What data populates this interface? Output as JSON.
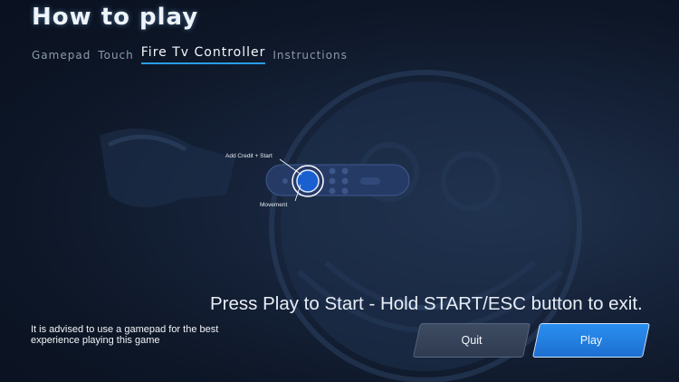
{
  "header": {
    "title": "How to play"
  },
  "tabs": [
    {
      "label": "Gamepad",
      "active": false
    },
    {
      "label": "Touch",
      "active": false
    },
    {
      "label": "Fire Tv Controller",
      "active": true
    },
    {
      "label": "Instructions",
      "active": false
    }
  ],
  "diagram": {
    "callout_start": "Add Credit + Start",
    "callout_movement": "Movement"
  },
  "main": {
    "headline": "Press Play to Start - Hold START/ESC button to exit.",
    "advice": "It is advised to use a gamepad for the best experience playing this game"
  },
  "buttons": {
    "quit_label": "Quit",
    "play_label": "Play"
  },
  "colors": {
    "accent": "#2a9df4",
    "background": "#16233a"
  }
}
